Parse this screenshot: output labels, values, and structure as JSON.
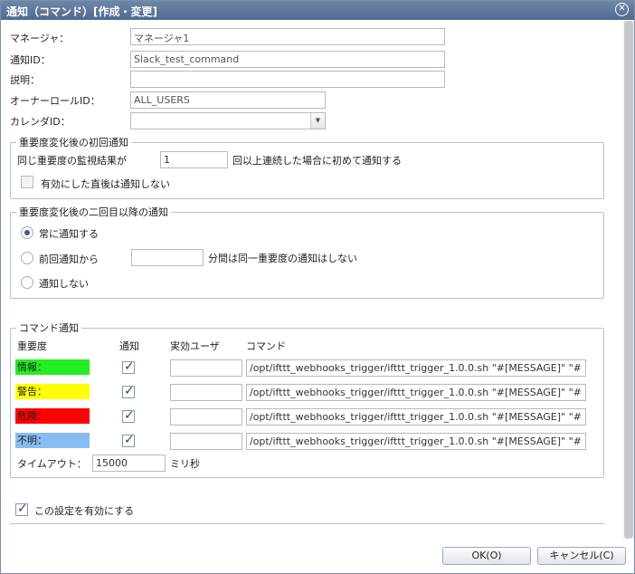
{
  "window": {
    "title": "通知（コマンド）[作成・変更]"
  },
  "colors": {
    "info": "#22ee22",
    "warning": "#ffff00",
    "critical": "#ff0000",
    "unknown": "#87bdf2"
  },
  "form": {
    "manager_label": "マネージャ：",
    "manager_value": "マネージャ1",
    "notify_id_label": "通知ID：",
    "notify_id_value": "Slack_test_command",
    "description_label": "説明：",
    "description_value": "",
    "owner_role_label": "オーナーロールID：",
    "owner_role_value": "ALL_USERS",
    "calendar_label": "カレンダID：",
    "calendar_value": ""
  },
  "first_notify": {
    "legend": "重要度変化後の初回通知",
    "same_result_label": "同じ重要度の監視結果が",
    "count_value": "1",
    "count_suffix": "回以上連続した場合に初めて通知する",
    "no_notify_after_enable_label": "有効にした直後は通知しない"
  },
  "second_notify": {
    "legend": "重要度変化後の二回目以降の通知",
    "always_label": "常に通知する",
    "since_last_label": "前回通知から",
    "minutes_value": "",
    "minutes_suffix": "分間は同一重要度の通知はしない",
    "never_label": "通知しない"
  },
  "command": {
    "legend": "コマンド通知",
    "headers": {
      "severity": "重要度",
      "notify": "通知",
      "user": "実効ユーザ",
      "command": "コマンド"
    },
    "rows": [
      {
        "severity": "情報：",
        "user": "",
        "command": "/opt/ifttt_webhooks_trigger/ifttt_trigger_1.0.0.sh \"#[MESSAGE]\" \"#"
      },
      {
        "severity": "警告：",
        "user": "",
        "command": "/opt/ifttt_webhooks_trigger/ifttt_trigger_1.0.0.sh \"#[MESSAGE]\" \"#"
      },
      {
        "severity": "危険：",
        "user": "",
        "command": "/opt/ifttt_webhooks_trigger/ifttt_trigger_1.0.0.sh \"#[MESSAGE]\" \"#"
      },
      {
        "severity": "不明：",
        "user": "",
        "command": "/opt/ifttt_webhooks_trigger/ifttt_trigger_1.0.0.sh \"#[MESSAGE]\" \"#"
      }
    ],
    "timeout_label": "タイムアウト：",
    "timeout_value": "15000",
    "timeout_unit": "ミリ秒"
  },
  "enable_label": "この設定を有効にする",
  "buttons": {
    "ok": "OK(O)",
    "cancel": "キャンセル(C)"
  },
  "icons": {
    "close": "close-icon",
    "check": "checkmark-icon",
    "dropdown": "chevron-down-icon"
  }
}
